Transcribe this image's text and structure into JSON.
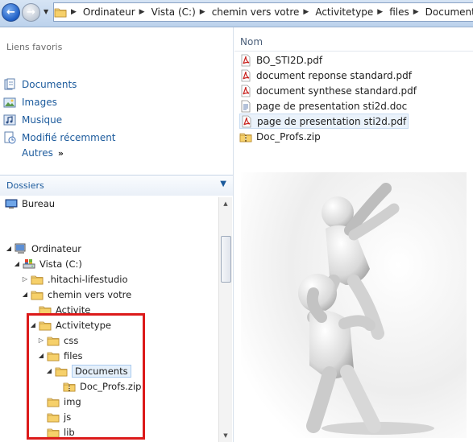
{
  "address_bar": {
    "crumbs": [
      "Ordinateur",
      "Vista (C:)",
      "chemin vers votre",
      "Activitetype",
      "files",
      "Documents"
    ]
  },
  "favorites": {
    "title": "Liens favoris",
    "items": [
      {
        "label": "Documents",
        "icon": "documents-icon"
      },
      {
        "label": "Images",
        "icon": "images-icon"
      },
      {
        "label": "Musique",
        "icon": "music-icon"
      },
      {
        "label": "Modifié récemment",
        "icon": "recent-icon"
      }
    ],
    "more_label": "Autres"
  },
  "folders": {
    "header": "Dossiers",
    "tree": [
      {
        "label": "Bureau",
        "icon": "desktop-icon"
      },
      {
        "label": "Ordinateur",
        "icon": "computer-icon"
      },
      {
        "label": "Vista (C:)",
        "icon": "drive-icon"
      },
      {
        "label": ".hitachi-lifestudio",
        "icon": "folder-icon"
      },
      {
        "label": "chemin vers votre",
        "icon": "folder-icon"
      },
      {
        "label": "Activite",
        "icon": "folder-icon"
      },
      {
        "label": "Activitetype",
        "icon": "folder-icon"
      },
      {
        "label": "css",
        "icon": "folder-icon"
      },
      {
        "label": "files",
        "icon": "folder-icon"
      },
      {
        "label": "Documents",
        "icon": "folder-icon"
      },
      {
        "label": "Doc_Profs.zip",
        "icon": "zip-folder-icon"
      },
      {
        "label": "img",
        "icon": "folder-icon"
      },
      {
        "label": "js",
        "icon": "folder-icon"
      },
      {
        "label": "lib",
        "icon": "folder-icon"
      }
    ]
  },
  "file_list": {
    "column_name": "Nom",
    "files": [
      {
        "name": "BO_STI2D.pdf",
        "icon": "pdf-icon"
      },
      {
        "name": "document reponse standard.pdf",
        "icon": "pdf-icon"
      },
      {
        "name": "document synthese standard.pdf",
        "icon": "pdf-icon"
      },
      {
        "name": "page de presentation sti2d.doc",
        "icon": "doc-icon"
      },
      {
        "name": "page de presentation sti2d.pdf",
        "icon": "pdf-icon"
      },
      {
        "name": "Doc_Profs.zip",
        "icon": "zip-folder-icon"
      }
    ]
  },
  "colors": {
    "accent_link": "#1b5a9c",
    "highlight_border": "#dc1a1a",
    "pdf_red": "#c8201c",
    "folder_yellow": "#f2c64a"
  }
}
